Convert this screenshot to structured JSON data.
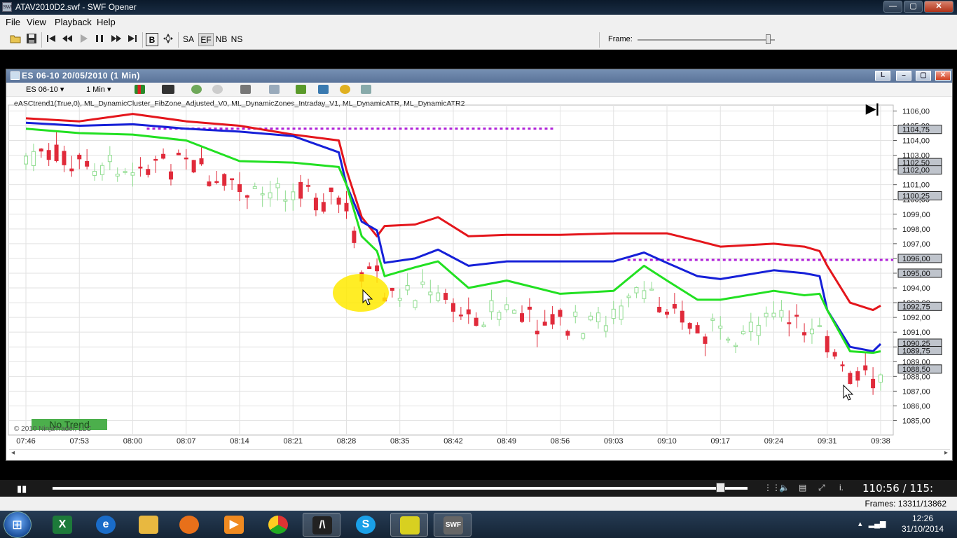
{
  "window": {
    "title": "ATAV2010D2.swf - SWF Opener",
    "minimize": "—",
    "maximize": "▢",
    "close": "✕"
  },
  "menu": [
    "File",
    "View",
    "Playback",
    "Help"
  ],
  "toolbar": {
    "buttons": {
      "b": "B",
      "sa": "SA",
      "ef": "EF",
      "nb": "NB",
      "ns": "NS"
    },
    "frame_label": "Frame:",
    "frame_slider": 0.94
  },
  "chart_window": {
    "title": "ES 06-10  20/05/2010 (1 Min)",
    "instrument": "ES 06-10",
    "interval": "1 Min",
    "indicators": "eASCtrend1(True,0), ML_DynamicCluster_FibZone_Adjusted_V0, ML_DynamicZones_Intraday_V1, ML_DynamicATR, ML_DynamicATR2",
    "trend_badge": "No Trend",
    "copyright": "© 2010 NinjaTrader, LLC"
  },
  "chart_data": {
    "type": "line",
    "title": "ES 06-10  20/05/2010 (1 Min)",
    "x_ticks": [
      "07:46",
      "07:53",
      "08:00",
      "08:07",
      "08:14",
      "08:21",
      "08:28",
      "08:35",
      "08:42",
      "08:49",
      "08:56",
      "09:03",
      "09:10",
      "09:17",
      "09:24",
      "09:31",
      "09:38"
    ],
    "y_ticks": [
      "1106,00",
      "1105,00",
      "1104,00",
      "1103,00",
      "1102,00",
      "1101,00",
      "1100,00",
      "1099,00",
      "1098,00",
      "1097,00",
      "1096,00",
      "1095,00",
      "1094,00",
      "1093,00",
      "1092,00",
      "1091,00",
      "1090,00",
      "1089,00",
      "1088,00",
      "1087,00",
      "1086,00",
      "1085,00"
    ],
    "ylim": [
      1084.5,
      1106.4
    ],
    "price_markers": [
      "1104,75",
      "1102,50",
      "1102,00",
      "1100,25",
      "1096,00",
      "1095,00",
      "1092,75",
      "1090,25",
      "1089,75",
      "1088,50"
    ],
    "dashed_levels": [
      {
        "value": 1104.8,
        "from": "08:00",
        "to": "08:56"
      },
      {
        "value": 1095.9,
        "from": "09:03",
        "to": "09:38"
      }
    ],
    "series": [
      {
        "color": "#e4161c",
        "x": [
          "07:46",
          "07:53",
          "08:00",
          "08:07",
          "08:14",
          "08:21",
          "08:27",
          "08:28",
          "08:30",
          "08:32",
          "08:33",
          "08:37",
          "08:40",
          "08:44",
          "08:49",
          "08:56",
          "09:03",
          "09:10",
          "09:14",
          "09:17",
          "09:24",
          "09:28",
          "09:30",
          "09:31",
          "09:34",
          "09:37",
          "09:38"
        ],
        "y": [
          1105.5,
          1105.3,
          1105.8,
          1105.3,
          1105.0,
          1104.4,
          1104.0,
          1102.0,
          1098.8,
          1097.5,
          1098.2,
          1098.3,
          1098.8,
          1097.5,
          1097.6,
          1097.6,
          1097.7,
          1097.7,
          1097.2,
          1096.8,
          1097.0,
          1096.8,
          1096.5,
          1095.5,
          1093.0,
          1092.5,
          1092.8
        ]
      },
      {
        "color": "#1620d8",
        "x": [
          "07:46",
          "07:53",
          "08:00",
          "08:07",
          "08:14",
          "08:21",
          "08:27",
          "08:28",
          "08:30",
          "08:32",
          "08:33",
          "08:37",
          "08:40",
          "08:44",
          "08:49",
          "08:56",
          "09:03",
          "09:07",
          "09:10",
          "09:14",
          "09:17",
          "09:24",
          "09:28",
          "09:30",
          "09:31",
          "09:34",
          "09:37",
          "09:38"
        ],
        "y": [
          1105.2,
          1105.0,
          1105.1,
          1104.8,
          1104.6,
          1104.3,
          1103.2,
          1101.0,
          1098.5,
          1097.9,
          1095.7,
          1096.0,
          1096.6,
          1095.5,
          1095.8,
          1095.8,
          1095.8,
          1096.4,
          1095.7,
          1094.8,
          1094.6,
          1095.2,
          1095.0,
          1094.8,
          1092.5,
          1090.0,
          1089.7,
          1090.2
        ]
      },
      {
        "color": "#22e022",
        "x": [
          "07:46",
          "07:53",
          "08:00",
          "08:07",
          "08:14",
          "08:21",
          "08:27",
          "08:28",
          "08:30",
          "08:32",
          "08:33",
          "08:37",
          "08:40",
          "08:44",
          "08:49",
          "08:56",
          "09:03",
          "09:07",
          "09:10",
          "09:14",
          "09:17",
          "09:24",
          "09:28",
          "09:30",
          "09:31",
          "09:34",
          "09:37",
          "09:38"
        ],
        "y": [
          1104.8,
          1104.5,
          1104.4,
          1104.0,
          1102.6,
          1102.5,
          1102.2,
          1101.0,
          1097.5,
          1096.5,
          1094.8,
          1095.4,
          1095.8,
          1094.0,
          1094.5,
          1093.6,
          1093.8,
          1095.5,
          1094.5,
          1093.2,
          1093.2,
          1093.8,
          1093.5,
          1093.6,
          1092.5,
          1089.7,
          1089.6,
          1089.7
        ]
      }
    ],
    "grid": true
  },
  "player": {
    "play_pause": "▮▮",
    "time": "110:56 / 115:",
    "progress": 0.96
  },
  "status": {
    "frames": "Frames: 13311/13862"
  },
  "taskbar": {
    "clock_time": "12:26",
    "clock_date": "31/10/2014",
    "apps": [
      "excel-app",
      "internet-explorer-app",
      "file-explorer-app",
      "firefox-app",
      "media-player-app",
      "chrome-app",
      "app-7",
      "skype-app",
      "app-9",
      "swf-opener-app"
    ]
  }
}
